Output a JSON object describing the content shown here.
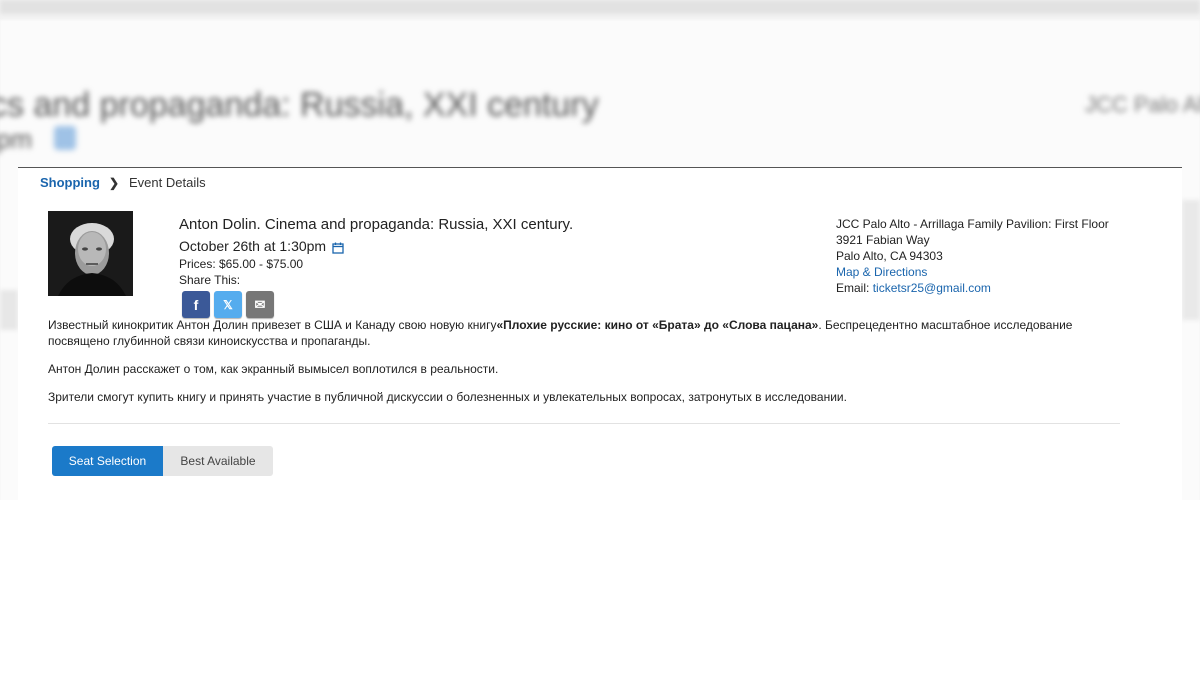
{
  "breadcrumb": {
    "link": "Shopping",
    "current": "Event Details"
  },
  "event": {
    "title": "Anton Dolin. Cinema and propaganda: Russia, XXI century.",
    "date": "October 26th at 1:30pm",
    "prices": "Prices: $65.00 - $75.00",
    "share_label": "Share This:",
    "share_buttons": [
      "f",
      "𝕏",
      "✉"
    ]
  },
  "venue": {
    "name": "JCC Palo Alto - Arrillaga Family Pavilion: First Floor",
    "street": "3921 Fabian Way",
    "city": "Palo Alto, CA 94303",
    "map_link": "Map & Directions",
    "email_label": "Email: ",
    "email": "ticketsr25@gmail.com"
  },
  "description": {
    "p1_pre": "Известный кинокритик Антон Долин привезет в США и Канаду свою новую книгу",
    "p1_bold": "«Плохие русские: кино от «Брата» до «Слова пацана»",
    "p1_post": ". Беспрецедентно масштабное исследование посвящено глубинной связи киноискусства и пропаганды.",
    "p2": "Антон Долин расскажет о том, как экранный вымысел воплотился в реальности.",
    "p3": "Зрители смогут купить книгу и принять участие в публичной дискуссии о болезненных и увлекательных вопросах, затронутых в исследовании."
  },
  "tabs": {
    "seat_selection": "Seat Selection",
    "best_available": "Best Available"
  },
  "background": {
    "title": "cs and propaganda: Russia, XXI century",
    "subtitle": "pm",
    "right": "JCC Palo Alto"
  },
  "colors": {
    "link": "#1a65ad",
    "primary_button": "#1b7ac9",
    "facebook": "#3b5998",
    "twitter": "#55acee",
    "email": "#777777"
  }
}
